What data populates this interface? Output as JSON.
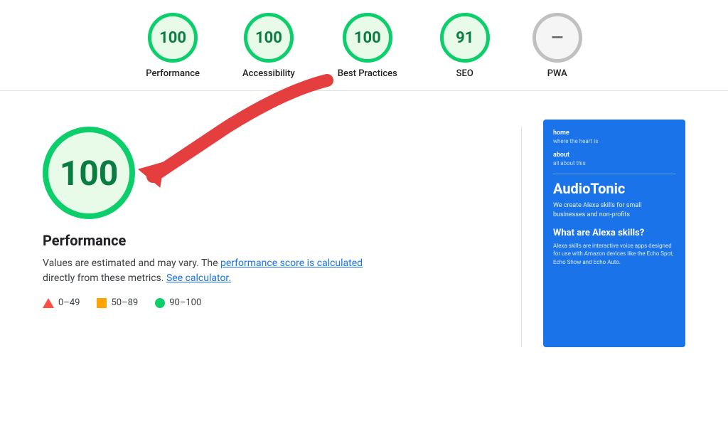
{
  "topbar": {
    "scores": [
      {
        "id": "performance",
        "value": "100",
        "label": "Performance",
        "type": "green"
      },
      {
        "id": "accessibility",
        "value": "100",
        "label": "Accessibility",
        "type": "green"
      },
      {
        "id": "best-practices",
        "value": "100",
        "label": "Best Practices",
        "type": "green"
      },
      {
        "id": "seo",
        "value": "91",
        "label": "SEO",
        "type": "green"
      },
      {
        "id": "pwa",
        "value": "—",
        "label": "PWA",
        "type": "gray"
      }
    ]
  },
  "main": {
    "big_score": "100",
    "title": "Performance",
    "description_before": "Values are estimated and may vary. The",
    "link1_text": "performance score is calculated",
    "description_middle": "directly from these metrics.",
    "link2_text": "See calculator.",
    "legend": [
      {
        "id": "red",
        "range": "0–49",
        "shape": "triangle",
        "color": "#ff4e42"
      },
      {
        "id": "orange",
        "range": "50–89",
        "shape": "square",
        "color": "#ffa400"
      },
      {
        "id": "green",
        "range": "90–100",
        "shape": "circle",
        "color": "#0cce6b"
      }
    ]
  },
  "preview": {
    "nav1": "home",
    "nav1_sub": "where the heart is",
    "nav2": "about",
    "nav2_sub": "all about this",
    "brand": "AudioTonic",
    "tagline": "We create Alexa skills for small businesses and non-profits",
    "section_title": "What are Alexa skills?",
    "section_body": "Alexa skills are interactive voice apps designed for use with Amazon devices like the Echo Spot, Echo Show and Echo Auto."
  }
}
